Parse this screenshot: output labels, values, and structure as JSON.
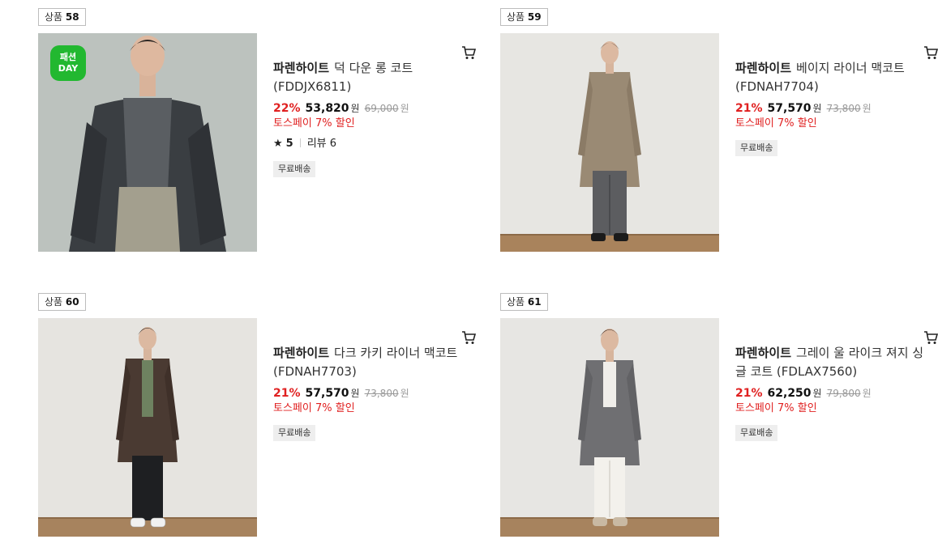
{
  "products": [
    {
      "badge_label": "상품",
      "badge_number": "58",
      "brand": "파렌하이트",
      "name": "덕 다운 롱 코트 (FDDJX6811)",
      "discount": "22%",
      "price": "53,820",
      "currency": "원",
      "original_price": "69,000",
      "original_currency": "원",
      "toss_discount": "토스페이 7% 할인",
      "rating": {
        "star_icon": "★",
        "score": "5",
        "review_text": "리뷰 6"
      },
      "shipping": "무료배송",
      "promo_badge": {
        "line1": "패션",
        "line2": "DAY",
        "color": "#22b830"
      },
      "cart_icon": "cart-icon"
    },
    {
      "badge_label": "상품",
      "badge_number": "59",
      "brand": "파렌하이트",
      "name": "베이지 라이너 맥코트 (FDNAH7704)",
      "discount": "21%",
      "price": "57,570",
      "currency": "원",
      "original_price": "73,800",
      "original_currency": "원",
      "toss_discount": "토스페이 7% 할인",
      "shipping": "무료배송",
      "cart_icon": "cart-icon"
    },
    {
      "badge_label": "상품",
      "badge_number": "60",
      "brand": "파렌하이트",
      "name": "다크 카키 라이너 맥코트 (FDNAH7703)",
      "discount": "21%",
      "price": "57,570",
      "currency": "원",
      "original_price": "73,800",
      "original_currency": "원",
      "toss_discount": "토스페이 7% 할인",
      "shipping": "무료배송",
      "cart_icon": "cart-icon"
    },
    {
      "badge_label": "상품",
      "badge_number": "61",
      "brand": "파렌하이트",
      "name": "그레이 울 라이크 져지 싱글 코트 (FDLAX7560)",
      "discount": "21%",
      "price": "62,250",
      "currency": "원",
      "original_price": "79,800",
      "original_currency": "원",
      "toss_discount": "토스페이 7% 할인",
      "shipping": "무료배송",
      "cart_icon": "cart-icon"
    }
  ],
  "colors": {
    "discount_red": "#e02020",
    "badge_border": "#bdbdbd",
    "shipping_bg": "#eeeeee"
  }
}
